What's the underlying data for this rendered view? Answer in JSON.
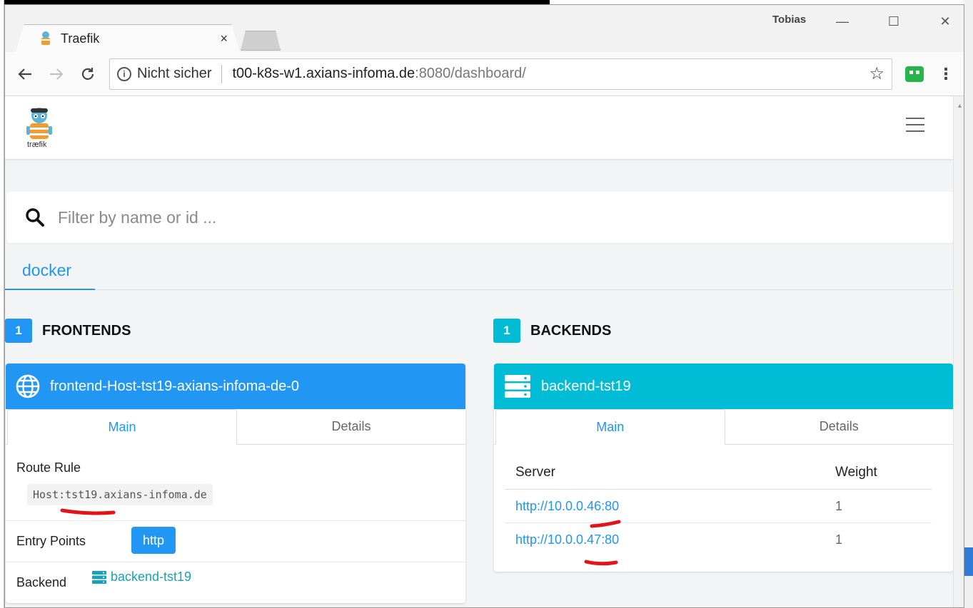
{
  "browser": {
    "tab_title": "Traefik",
    "tab_close": "×",
    "profile_name": "Tobias",
    "security_label": "Nicht sicher",
    "url_host": "t00-k8s-w1.axians-infoma.de",
    "url_rest": ":8080/dashboard/"
  },
  "app": {
    "logo_text": "træfik",
    "search_placeholder": "Filter by name or id ...",
    "provider_tab": "docker"
  },
  "frontends": {
    "count": "1",
    "heading": "FRONTENDS",
    "card": {
      "name": "frontend-Host-tst19-axians-infoma-de-0",
      "tabs": [
        "Main",
        "Details"
      ],
      "route_rule_label": "Route Rule",
      "route_rule": "Host:tst19.axians-infoma.de",
      "entry_points_label": "Entry Points",
      "entry_point": "http",
      "backend_label": "Backend",
      "backend": "backend-tst19"
    }
  },
  "backends": {
    "count": "1",
    "heading": "BACKENDS",
    "card": {
      "name": "backend-tst19",
      "tabs": [
        "Main",
        "Details"
      ],
      "columns": [
        "Server",
        "Weight"
      ],
      "servers": [
        {
          "url": "http://10.0.0.46:80",
          "weight": "1"
        },
        {
          "url": "http://10.0.0.47:80",
          "weight": "1"
        }
      ]
    }
  },
  "colors": {
    "frontend_header": "#2196f3",
    "backend_header": "#00bcd4",
    "link": "#2196f3",
    "annotation_red": "#e0141a"
  }
}
